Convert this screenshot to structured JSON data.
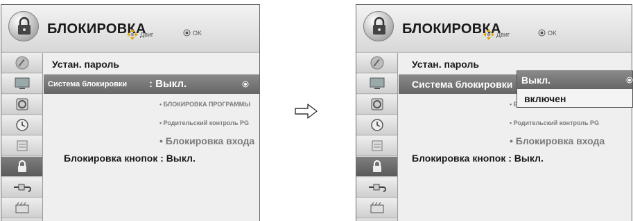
{
  "left": {
    "title": "БЛОКИРОВКА",
    "hint_move": "Двиг",
    "hint_ok": "OK",
    "set_password": "Устан. пароль",
    "lock_system_label": "Система блокировки",
    "lock_system_value": ": Выкл.",
    "program_lock": "• БЛОКИРОВКА ПРОГРАММЫ",
    "parental_control": "• Родительский контроль PG",
    "input_lock": "• Блокировка входа",
    "key_lock": "Блокировка кнопок : Выкл."
  },
  "right": {
    "title": "БЛОКИРОВКА",
    "hint_move": "Двиг",
    "hint_ok": "OK",
    "set_password": "Устан. пароль",
    "lock_system_label": "Система блокировки",
    "program_lock_partial": "• Е",
    "parental_control": "• Родительский контроль PG",
    "input_lock": "• Блокировка входа",
    "key_lock": "Блокировка кнопок : Выкл.",
    "dropdown_options": [
      "Выкл.",
      "включен"
    ]
  },
  "sidebar_icons": [
    "satellite-dish-icon",
    "monitor-icon",
    "speaker-icon",
    "clock-icon",
    "option-icon",
    "lock-icon",
    "input-plug-icon",
    "media-icon"
  ],
  "active_sidebar_index": 5,
  "colors": {
    "highlight": "#777777",
    "panel": "#efefef",
    "sub_text": "#7a7a7a"
  }
}
